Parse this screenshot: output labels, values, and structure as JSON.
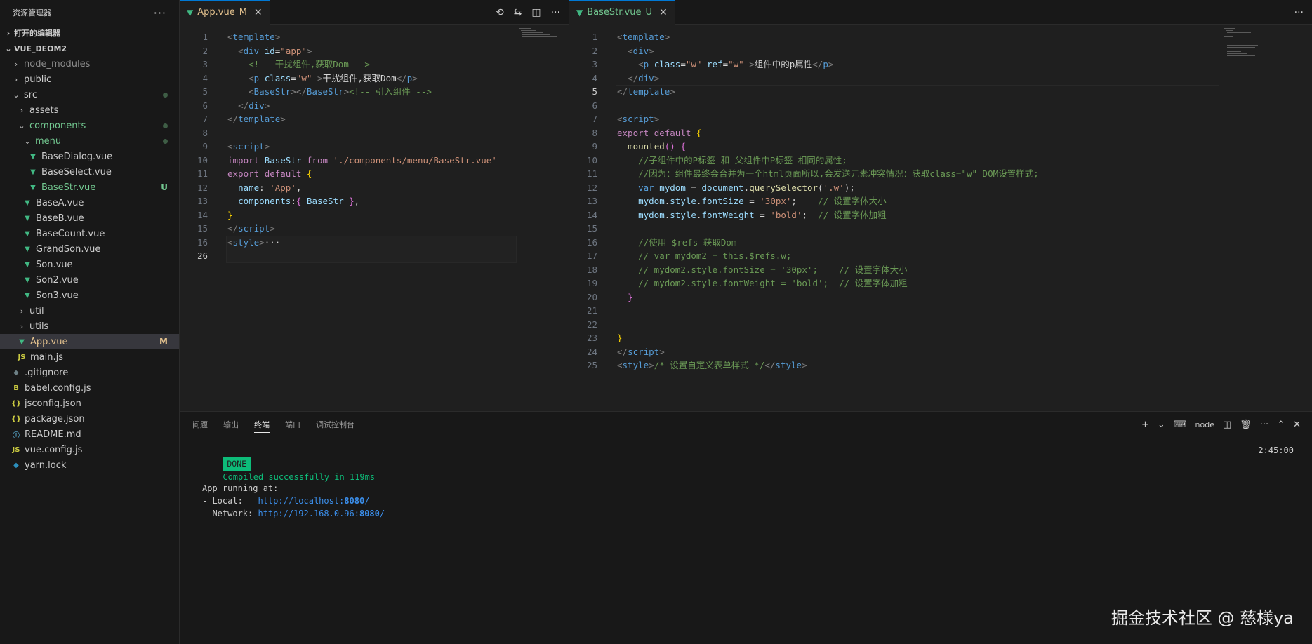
{
  "explorer": {
    "title": "资源管理器",
    "more": "···",
    "open_editors": "打开的编辑器",
    "project": "VUE_DEOM2",
    "tree": [
      {
        "label": "node_modules",
        "type": "folder",
        "depth": 0,
        "open": false,
        "color": "dim"
      },
      {
        "label": "public",
        "type": "folder",
        "depth": 0,
        "open": false
      },
      {
        "label": "src",
        "type": "folder",
        "depth": 0,
        "open": true,
        "dot": true
      },
      {
        "label": "assets",
        "type": "folder",
        "depth": 1,
        "open": false
      },
      {
        "label": "components",
        "type": "folder",
        "depth": 1,
        "open": true,
        "color": "green",
        "dot": true
      },
      {
        "label": "menu",
        "type": "folder",
        "depth": 2,
        "open": true,
        "color": "green",
        "dot": true
      },
      {
        "label": "BaseDialog.vue",
        "type": "vue",
        "depth": 3
      },
      {
        "label": "BaseSelect.vue",
        "type": "vue",
        "depth": 3
      },
      {
        "label": "BaseStr.vue",
        "type": "vue",
        "depth": 3,
        "color": "green",
        "badge": "U"
      },
      {
        "label": "BaseA.vue",
        "type": "vue",
        "depth": 2
      },
      {
        "label": "BaseB.vue",
        "type": "vue",
        "depth": 2
      },
      {
        "label": "BaseCount.vue",
        "type": "vue",
        "depth": 2
      },
      {
        "label": "GrandSon.vue",
        "type": "vue",
        "depth": 2
      },
      {
        "label": "Son.vue",
        "type": "vue",
        "depth": 2
      },
      {
        "label": "Son2.vue",
        "type": "vue",
        "depth": 2
      },
      {
        "label": "Son3.vue",
        "type": "vue",
        "depth": 2
      },
      {
        "label": "util",
        "type": "folder",
        "depth": 1,
        "open": false
      },
      {
        "label": "utils",
        "type": "folder",
        "depth": 1,
        "open": false
      },
      {
        "label": "App.vue",
        "type": "vue",
        "depth": 1,
        "color": "mod",
        "badge": "M",
        "active": true
      },
      {
        "label": "main.js",
        "type": "js",
        "depth": 1
      },
      {
        "label": ".gitignore",
        "type": "git",
        "depth": 0
      },
      {
        "label": "babel.config.js",
        "type": "babel",
        "depth": 0
      },
      {
        "label": "jsconfig.json",
        "type": "json",
        "depth": 0
      },
      {
        "label": "package.json",
        "type": "json",
        "depth": 0
      },
      {
        "label": "README.md",
        "type": "info",
        "depth": 0
      },
      {
        "label": "vue.config.js",
        "type": "js",
        "depth": 0
      },
      {
        "label": "yarn.lock",
        "type": "yarn",
        "depth": 0
      }
    ]
  },
  "icons": {
    "chevron_right": "›",
    "chevron_down": "⌄",
    "vue": "▼",
    "js": "JS",
    "json": "{}",
    "info": "ⓘ",
    "git": "◆",
    "babel": "B",
    "yarn": "◆",
    "close": "✕",
    "history": "⟲",
    "compare": "⇆",
    "split": "◫",
    "more": "···",
    "plus": "+",
    "caret": "⌄",
    "terminal": "⌨",
    "trash": "🗑",
    "maximize": "⌃"
  },
  "editor_left": {
    "tab": {
      "name": "App.vue",
      "status": "M"
    },
    "lines": [
      {
        "n": "1",
        "html": "<span class='t-gray'>&lt;</span><span class='t-tag'>template</span><span class='t-gray'>&gt;</span>"
      },
      {
        "n": "2",
        "html": "  <span class='t-gray'>&lt;</span><span class='t-tag'>div</span> <span class='t-attr'>id</span><span class='t-txt'>=</span><span class='t-str'>\"app\"</span><span class='t-gray'>&gt;</span>"
      },
      {
        "n": "3",
        "html": "    <span class='t-cmt'>&lt;!-- 干扰组件,获取Dom --&gt;</span>"
      },
      {
        "n": "4",
        "html": "    <span class='t-gray'>&lt;</span><span class='t-tag'>p</span> <span class='t-attr'>class</span><span class='t-txt'>=</span><span class='t-str'>\"w\"</span> <span class='t-gray'>&gt;</span><span class='t-txt'>干扰组件,获取Dom</span><span class='t-gray'>&lt;/</span><span class='t-tag'>p</span><span class='t-gray'>&gt;</span>"
      },
      {
        "n": "5",
        "html": "    <span class='t-gray'>&lt;</span><span class='t-tag'>BaseStr</span><span class='t-gray'>&gt;&lt;/</span><span class='t-tag'>BaseStr</span><span class='t-gray'>&gt;</span><span class='t-cmt'>&lt;!-- 引入组件 --&gt;</span>"
      },
      {
        "n": "6",
        "html": "  <span class='t-gray'>&lt;/</span><span class='t-tag'>div</span><span class='t-gray'>&gt;</span>"
      },
      {
        "n": "7",
        "html": "<span class='t-gray'>&lt;/</span><span class='t-tag'>template</span><span class='t-gray'>&gt;</span>"
      },
      {
        "n": "8",
        "html": ""
      },
      {
        "n": "9",
        "html": "<span class='t-gray'>&lt;</span><span class='t-tag'>script</span><span class='t-gray'>&gt;</span>"
      },
      {
        "n": "10",
        "html": "<span class='t-kw'>import</span> <span class='t-var'>BaseStr</span> <span class='t-kw'>from</span> <span class='t-str'>'./components/menu/BaseStr.vue'</span>"
      },
      {
        "n": "11",
        "html": "<span class='t-kw'>export</span> <span class='t-kw'>default</span> <span class='t-br'>{</span>"
      },
      {
        "n": "12",
        "html": "  <span class='t-var'>name</span><span class='t-txt'>: </span><span class='t-str'>'App'</span><span class='t-txt'>,</span>"
      },
      {
        "n": "13",
        "html": "  <span class='t-var'>components</span><span class='t-txt'>:</span><span class='t-br2'>{</span> <span class='t-var'>BaseStr</span> <span class='t-br2'>}</span><span class='t-txt'>,</span>"
      },
      {
        "n": "14",
        "html": "<span class='t-br'>}</span>"
      },
      {
        "n": "15",
        "html": "<span class='t-gray'>&lt;/</span><span class='t-tag'>script</span><span class='t-gray'>&gt;</span>"
      },
      {
        "n": "16",
        "html": "<span class='t-gray'>&lt;</span><span class='t-tag'>style</span><span class='t-gray'>&gt;</span><span class='t-txt'>···</span>"
      },
      {
        "n": "26",
        "html": ""
      }
    ]
  },
  "editor_right": {
    "tab": {
      "name": "BaseStr.vue",
      "status": "U"
    },
    "lines": [
      {
        "n": "1",
        "html": "<span class='t-gray'>&lt;</span><span class='t-tag'>template</span><span class='t-gray'>&gt;</span>"
      },
      {
        "n": "2",
        "html": "  <span class='t-gray'>&lt;</span><span class='t-tag'>div</span><span class='t-gray'>&gt;</span>"
      },
      {
        "n": "3",
        "html": "    <span class='t-gray'>&lt;</span><span class='t-tag'>p</span> <span class='t-attr'>class</span><span class='t-txt'>=</span><span class='t-str'>\"w\"</span> <span class='t-attr'>ref</span><span class='t-txt'>=</span><span class='t-str'>\"w\"</span> <span class='t-gray'>&gt;</span><span class='t-txt'>组件中的p属性</span><span class='t-gray'>&lt;/</span><span class='t-tag'>p</span><span class='t-gray'>&gt;</span>"
      },
      {
        "n": "4",
        "html": "  <span class='t-gray'>&lt;/</span><span class='t-tag'>div</span><span class='t-gray'>&gt;</span>"
      },
      {
        "n": "5",
        "html": "<span class='t-gray'>&lt;/</span><span class='t-tag'>template</span><span class='t-gray'>&gt;</span>"
      },
      {
        "n": "6",
        "html": ""
      },
      {
        "n": "7",
        "html": "<span class='t-gray'>&lt;</span><span class='t-tag'>script</span><span class='t-gray'>&gt;</span>"
      },
      {
        "n": "8",
        "html": "<span class='t-kw'>export</span> <span class='t-kw'>default</span> <span class='t-br'>{</span>"
      },
      {
        "n": "9",
        "html": "  <span class='t-fn'>mounted</span><span class='t-br2'>()</span> <span class='t-br2'>{</span>"
      },
      {
        "n": "10",
        "html": "    <span class='t-cmt'>//子组件中的P标签 和 父组件中P标签 相同的属性;</span>"
      },
      {
        "n": "11",
        "html": "    <span class='t-cmt'>//因为：组件最终会合并为一个html页面所以,会发送元素冲突情况：获取class=\"w\" DOM设置样式;</span>"
      },
      {
        "n": "12",
        "html": "    <span class='t-kw2'>var</span> <span class='t-var'>mydom</span> <span class='t-txt'>=</span> <span class='t-var'>document</span><span class='t-txt'>.</span><span class='t-fn'>querySelector</span><span class='t-txt'>(</span><span class='t-str'>'.w'</span><span class='t-txt'>);</span>"
      },
      {
        "n": "13",
        "html": "    <span class='t-var'>mydom</span><span class='t-txt'>.</span><span class='t-var'>style</span><span class='t-txt'>.</span><span class='t-var'>fontSize</span> <span class='t-txt'>=</span> <span class='t-str'>'30px'</span><span class='t-txt'>;</span>    <span class='t-cmt'>// 设置字体大小</span>"
      },
      {
        "n": "14",
        "html": "    <span class='t-var'>mydom</span><span class='t-txt'>.</span><span class='t-var'>style</span><span class='t-txt'>.</span><span class='t-var'>fontWeight</span> <span class='t-txt'>=</span> <span class='t-str'>'bold'</span><span class='t-txt'>;</span>  <span class='t-cmt'>// 设置字体加粗</span>"
      },
      {
        "n": "15",
        "html": ""
      },
      {
        "n": "16",
        "html": "    <span class='t-cmt'>//使用 $refs 获取Dom</span>"
      },
      {
        "n": "17",
        "html": "    <span class='t-cmt'>// var mydom2 = this.$refs.w;</span>"
      },
      {
        "n": "18",
        "html": "    <span class='t-cmt'>// mydom2.style.fontSize = '30px';    // 设置字体大小</span>"
      },
      {
        "n": "19",
        "html": "    <span class='t-cmt'>// mydom2.style.fontWeight = 'bold';  // 设置字体加粗</span>"
      },
      {
        "n": "20",
        "html": "  <span class='t-br2'>}</span>"
      },
      {
        "n": "21",
        "html": ""
      },
      {
        "n": "22",
        "html": ""
      },
      {
        "n": "23",
        "html": "<span class='t-br'>}</span>"
      },
      {
        "n": "24",
        "html": "<span class='t-gray'>&lt;/</span><span class='t-tag'>script</span><span class='t-gray'>&gt;</span>"
      },
      {
        "n": "25",
        "html": "<span class='t-gray'>&lt;</span><span class='t-tag'>style</span><span class='t-gray'>&gt;</span><span class='t-cmt'>/* 设置自定义表单样式 */</span><span class='t-gray'>&lt;/</span><span class='t-tag'>style</span><span class='t-gray'>&gt;</span>"
      }
    ]
  },
  "panel": {
    "tabs": [
      "问题",
      "输出",
      "终端",
      "端口",
      "调试控制台"
    ],
    "active_tab": "终端",
    "shell": "node",
    "time": "2:45:00",
    "done": "DONE",
    "compiled": "Compiled successfully in 119ms",
    "running": "App running at:",
    "local_label": "- Local:   ",
    "local_url": "http://localhost:",
    "local_port": "8080",
    "local_slash": "/",
    "network_label": "- Network: ",
    "network_url": "http://192.168.0.96:",
    "network_port": "8080",
    "network_slash": "/"
  },
  "watermark": "掘金技术社区 @ 慈様ya"
}
